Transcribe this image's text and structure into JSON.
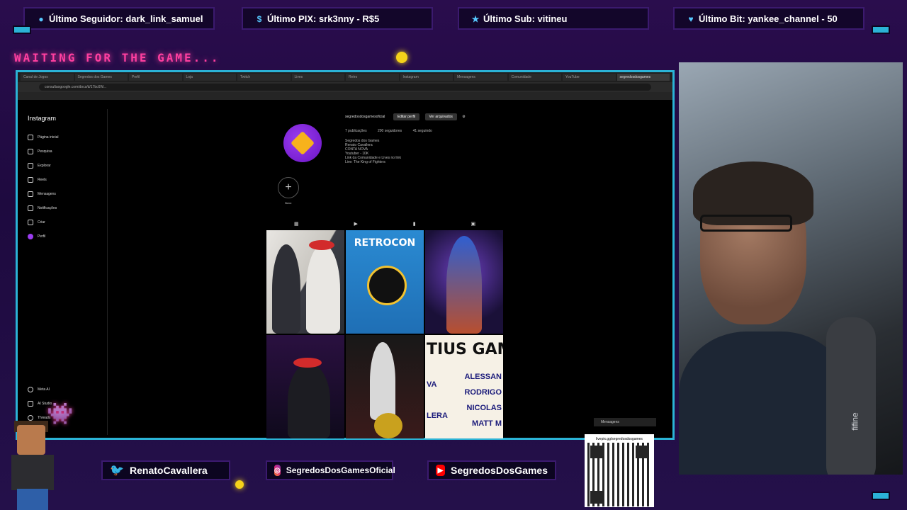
{
  "alerts": [
    {
      "label": "Último Seguidor: dark_link_samuel",
      "icon": "user-icon"
    },
    {
      "label": "Último PIX: srk3nny - R$5",
      "icon": "dollar-icon"
    },
    {
      "label": "Último Sub: vitineu",
      "icon": "star-icon"
    },
    {
      "label": "Último Bit: yankee_channel - 50",
      "icon": "heart-icon"
    }
  ],
  "waiting_text": "WAITING FOR THE GAME...",
  "browser": {
    "url": "consultaogoogle.com/docs/d/17bc6W...",
    "tabs": [
      "Canal de Jogos",
      "Segredos dos Games",
      "Perfil",
      "Loja",
      "Twitch",
      "Lives",
      "Retro",
      "Instagram",
      "Mensagens",
      "Comunidade",
      "YouTube",
      "segredosdosgames"
    ]
  },
  "instagram": {
    "logo": "Instagram",
    "nav": [
      "Página inicial",
      "Pesquisa",
      "Explorar",
      "Reels",
      "Mensagens",
      "Notificações",
      "Criar",
      "Perfil"
    ],
    "nav_bottom": [
      "Meta AI",
      "AI Studio",
      "Threads"
    ],
    "username": "segredosdosgamesoficial",
    "edit_profile": "Editar perfil",
    "view_archive": "Ver arquivados",
    "stats": {
      "posts": "7 publicações",
      "followers": "200 seguidores",
      "following": "41 seguindo"
    },
    "bio": [
      "Segredos dos Games",
      "Renato Cavallera",
      "CONTA NOVA",
      "Youtuber - 10K",
      "Link da Comunidade e Lives no link",
      "Live: The King of Fighters"
    ],
    "new_post_label": "Novo",
    "posts": [
      {
        "kind": "photo"
      },
      {
        "kind": "retrocon",
        "title": "RETROCON"
      },
      {
        "kind": "art"
      },
      {
        "kind": "photo"
      },
      {
        "kind": "photo"
      },
      {
        "kind": "text",
        "title": "TIUS GAM",
        "names": [
          "ALESSAN",
          "RODRIGO",
          "NICOLAS",
          "MATT M"
        ],
        "left": [
          "VA",
          "LERA"
        ]
      }
    ]
  },
  "social": {
    "twitter": "RenatoCavallera",
    "instagram": "SegredosDosGamesOficial",
    "youtube": "SegredosDosGames"
  },
  "qr": {
    "label": "livepix.gg/segredosdosgames"
  },
  "mini_chat": "Mensagens",
  "webcam": {
    "mic_brand": "fifine"
  }
}
